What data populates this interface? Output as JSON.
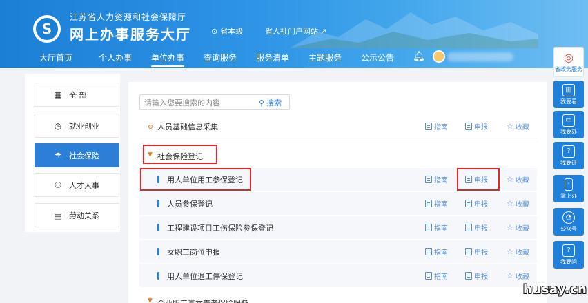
{
  "header": {
    "department": "江苏省人力资源和社会保障厅",
    "site_name": "网上办事服务大厅",
    "region": "省本级",
    "portal_link": "省人社门户网站",
    "nav": [
      "大厅首页",
      "个人办事",
      "单位办事",
      "查询服务",
      "服务清单",
      "主题服务",
      "公示公告"
    ],
    "active_nav": "单位办事"
  },
  "sidebar": {
    "items": [
      {
        "label": "全 部",
        "icon": "grid-icon"
      },
      {
        "label": "就业创业",
        "icon": "clock-icon"
      },
      {
        "label": "社会保险",
        "icon": "umbrella-icon"
      },
      {
        "label": "人才人事",
        "icon": "people-icon"
      },
      {
        "label": "劳动关系",
        "icon": "document-icon"
      }
    ],
    "active": "社会保险"
  },
  "search": {
    "placeholder": "请输入您要搜索的内容",
    "button": "搜索"
  },
  "actions": {
    "guide": "指南",
    "apply": "申报",
    "favorite": "收藏"
  },
  "services": {
    "row0": "人员基础信息采集",
    "row1": "社会保险登记",
    "row2": "用人单位用工参保登记",
    "row3": "人员参保登记",
    "row4": "工程建设项目工伤保险参保登记",
    "row5": "女职工岗位申报",
    "row6": "用人单位退工停保登记",
    "row7": "企业职工基本养老保险服务"
  },
  "right_toolbar": [
    "省政务服务",
    "我要看",
    "我要办",
    "我要评",
    "掌上办",
    "公众号",
    "我要问"
  ],
  "watermark": "husay.cn",
  "colors": {
    "primary": "#2c7ed6",
    "highlight": "#e3262a",
    "accent_orange": "#e07a2b"
  }
}
